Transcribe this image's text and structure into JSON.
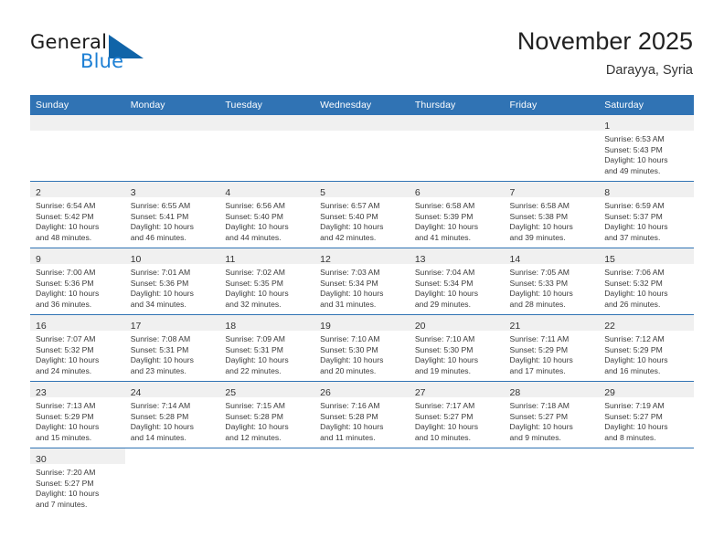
{
  "brand": {
    "name_part1": "General",
    "name_part2": "Blue",
    "triangle_color": "#1064a8",
    "blue_color": "#1c7fd4"
  },
  "header": {
    "title": "November 2025",
    "subtitle": "Darayya, Syria",
    "accent_color": "#3073b4"
  },
  "weekdays": [
    "Sunday",
    "Monday",
    "Tuesday",
    "Wednesday",
    "Thursday",
    "Friday",
    "Saturday"
  ],
  "labels": {
    "sunrise": "Sunrise:",
    "sunset": "Sunset:",
    "daylight": "Daylight:"
  },
  "weeks": [
    [
      {
        "day": "",
        "empty": true
      },
      {
        "day": "",
        "empty": true
      },
      {
        "day": "",
        "empty": true
      },
      {
        "day": "",
        "empty": true
      },
      {
        "day": "",
        "empty": true
      },
      {
        "day": "",
        "empty": true
      },
      {
        "day": "1",
        "sunrise": "Sunrise: 6:53 AM",
        "sunset": "Sunset: 5:43 PM",
        "daylight_l1": "Daylight: 10 hours",
        "daylight_l2": "and 49 minutes."
      }
    ],
    [
      {
        "day": "2",
        "sunrise": "Sunrise: 6:54 AM",
        "sunset": "Sunset: 5:42 PM",
        "daylight_l1": "Daylight: 10 hours",
        "daylight_l2": "and 48 minutes."
      },
      {
        "day": "3",
        "sunrise": "Sunrise: 6:55 AM",
        "sunset": "Sunset: 5:41 PM",
        "daylight_l1": "Daylight: 10 hours",
        "daylight_l2": "and 46 minutes."
      },
      {
        "day": "4",
        "sunrise": "Sunrise: 6:56 AM",
        "sunset": "Sunset: 5:40 PM",
        "daylight_l1": "Daylight: 10 hours",
        "daylight_l2": "and 44 minutes."
      },
      {
        "day": "5",
        "sunrise": "Sunrise: 6:57 AM",
        "sunset": "Sunset: 5:40 PM",
        "daylight_l1": "Daylight: 10 hours",
        "daylight_l2": "and 42 minutes."
      },
      {
        "day": "6",
        "sunrise": "Sunrise: 6:58 AM",
        "sunset": "Sunset: 5:39 PM",
        "daylight_l1": "Daylight: 10 hours",
        "daylight_l2": "and 41 minutes."
      },
      {
        "day": "7",
        "sunrise": "Sunrise: 6:58 AM",
        "sunset": "Sunset: 5:38 PM",
        "daylight_l1": "Daylight: 10 hours",
        "daylight_l2": "and 39 minutes."
      },
      {
        "day": "8",
        "sunrise": "Sunrise: 6:59 AM",
        "sunset": "Sunset: 5:37 PM",
        "daylight_l1": "Daylight: 10 hours",
        "daylight_l2": "and 37 minutes."
      }
    ],
    [
      {
        "day": "9",
        "sunrise": "Sunrise: 7:00 AM",
        "sunset": "Sunset: 5:36 PM",
        "daylight_l1": "Daylight: 10 hours",
        "daylight_l2": "and 36 minutes."
      },
      {
        "day": "10",
        "sunrise": "Sunrise: 7:01 AM",
        "sunset": "Sunset: 5:36 PM",
        "daylight_l1": "Daylight: 10 hours",
        "daylight_l2": "and 34 minutes."
      },
      {
        "day": "11",
        "sunrise": "Sunrise: 7:02 AM",
        "sunset": "Sunset: 5:35 PM",
        "daylight_l1": "Daylight: 10 hours",
        "daylight_l2": "and 32 minutes."
      },
      {
        "day": "12",
        "sunrise": "Sunrise: 7:03 AM",
        "sunset": "Sunset: 5:34 PM",
        "daylight_l1": "Daylight: 10 hours",
        "daylight_l2": "and 31 minutes."
      },
      {
        "day": "13",
        "sunrise": "Sunrise: 7:04 AM",
        "sunset": "Sunset: 5:34 PM",
        "daylight_l1": "Daylight: 10 hours",
        "daylight_l2": "and 29 minutes."
      },
      {
        "day": "14",
        "sunrise": "Sunrise: 7:05 AM",
        "sunset": "Sunset: 5:33 PM",
        "daylight_l1": "Daylight: 10 hours",
        "daylight_l2": "and 28 minutes."
      },
      {
        "day": "15",
        "sunrise": "Sunrise: 7:06 AM",
        "sunset": "Sunset: 5:32 PM",
        "daylight_l1": "Daylight: 10 hours",
        "daylight_l2": "and 26 minutes."
      }
    ],
    [
      {
        "day": "16",
        "sunrise": "Sunrise: 7:07 AM",
        "sunset": "Sunset: 5:32 PM",
        "daylight_l1": "Daylight: 10 hours",
        "daylight_l2": "and 24 minutes."
      },
      {
        "day": "17",
        "sunrise": "Sunrise: 7:08 AM",
        "sunset": "Sunset: 5:31 PM",
        "daylight_l1": "Daylight: 10 hours",
        "daylight_l2": "and 23 minutes."
      },
      {
        "day": "18",
        "sunrise": "Sunrise: 7:09 AM",
        "sunset": "Sunset: 5:31 PM",
        "daylight_l1": "Daylight: 10 hours",
        "daylight_l2": "and 22 minutes."
      },
      {
        "day": "19",
        "sunrise": "Sunrise: 7:10 AM",
        "sunset": "Sunset: 5:30 PM",
        "daylight_l1": "Daylight: 10 hours",
        "daylight_l2": "and 20 minutes."
      },
      {
        "day": "20",
        "sunrise": "Sunrise: 7:10 AM",
        "sunset": "Sunset: 5:30 PM",
        "daylight_l1": "Daylight: 10 hours",
        "daylight_l2": "and 19 minutes."
      },
      {
        "day": "21",
        "sunrise": "Sunrise: 7:11 AM",
        "sunset": "Sunset: 5:29 PM",
        "daylight_l1": "Daylight: 10 hours",
        "daylight_l2": "and 17 minutes."
      },
      {
        "day": "22",
        "sunrise": "Sunrise: 7:12 AM",
        "sunset": "Sunset: 5:29 PM",
        "daylight_l1": "Daylight: 10 hours",
        "daylight_l2": "and 16 minutes."
      }
    ],
    [
      {
        "day": "23",
        "sunrise": "Sunrise: 7:13 AM",
        "sunset": "Sunset: 5:29 PM",
        "daylight_l1": "Daylight: 10 hours",
        "daylight_l2": "and 15 minutes."
      },
      {
        "day": "24",
        "sunrise": "Sunrise: 7:14 AM",
        "sunset": "Sunset: 5:28 PM",
        "daylight_l1": "Daylight: 10 hours",
        "daylight_l2": "and 14 minutes."
      },
      {
        "day": "25",
        "sunrise": "Sunrise: 7:15 AM",
        "sunset": "Sunset: 5:28 PM",
        "daylight_l1": "Daylight: 10 hours",
        "daylight_l2": "and 12 minutes."
      },
      {
        "day": "26",
        "sunrise": "Sunrise: 7:16 AM",
        "sunset": "Sunset: 5:28 PM",
        "daylight_l1": "Daylight: 10 hours",
        "daylight_l2": "and 11 minutes."
      },
      {
        "day": "27",
        "sunrise": "Sunrise: 7:17 AM",
        "sunset": "Sunset: 5:27 PM",
        "daylight_l1": "Daylight: 10 hours",
        "daylight_l2": "and 10 minutes."
      },
      {
        "day": "28",
        "sunrise": "Sunrise: 7:18 AM",
        "sunset": "Sunset: 5:27 PM",
        "daylight_l1": "Daylight: 10 hours",
        "daylight_l2": "and 9 minutes."
      },
      {
        "day": "29",
        "sunrise": "Sunrise: 7:19 AM",
        "sunset": "Sunset: 5:27 PM",
        "daylight_l1": "Daylight: 10 hours",
        "daylight_l2": "and 8 minutes."
      }
    ],
    [
      {
        "day": "30",
        "sunrise": "Sunrise: 7:20 AM",
        "sunset": "Sunset: 5:27 PM",
        "daylight_l1": "Daylight: 10 hours",
        "daylight_l2": "and 7 minutes."
      },
      {
        "day": "",
        "blank": true
      },
      {
        "day": "",
        "blank": true
      },
      {
        "day": "",
        "blank": true
      },
      {
        "day": "",
        "blank": true
      },
      {
        "day": "",
        "blank": true
      },
      {
        "day": "",
        "blank": true
      }
    ]
  ]
}
